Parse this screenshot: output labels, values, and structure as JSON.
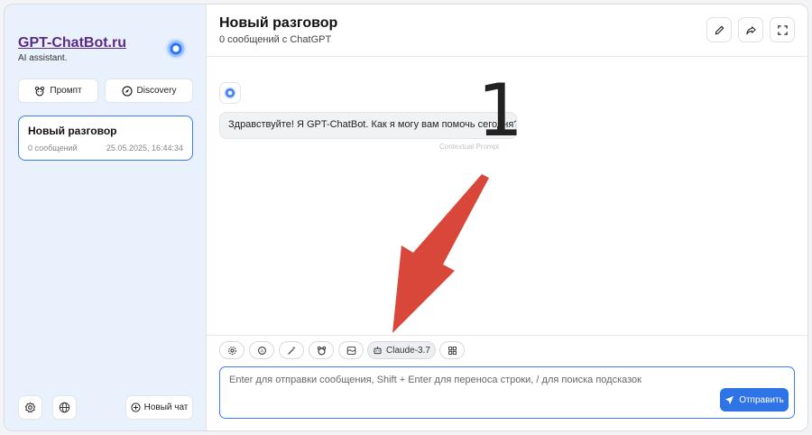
{
  "sidebar": {
    "brand_title": "GPT-ChatBot.ru",
    "brand_subtitle": "AI assistant.",
    "prompt_label": "Промпт",
    "discovery_label": "Discovery",
    "chat": {
      "title": "Новый разговор",
      "count": "0 сообщений",
      "date": "25.05.2025, 16:44:34"
    },
    "new_chat_label": "Новый чат"
  },
  "header": {
    "title": "Новый разговор",
    "subtitle": "0 сообщений с ChatGPT"
  },
  "messages": [
    {
      "text": "Здравствуйте! Я GPT-ChatBot. Как я могу вам помочь сегодня?"
    }
  ],
  "context_hint": "Contextual Prompt",
  "annotation": {
    "number": "1",
    "color": "#d9463a"
  },
  "toolbar": {
    "model_label": "Claude-3.7"
  },
  "input": {
    "placeholder": "Enter для отправки сообщения, Shift + Enter для переноса строки, / для поиска подсказок",
    "value": ""
  },
  "send_label": "Отправить",
  "colors": {
    "accent": "#2f74e6",
    "sidebar_bg": "#e9f1fd",
    "brand": "#5b2a86"
  }
}
